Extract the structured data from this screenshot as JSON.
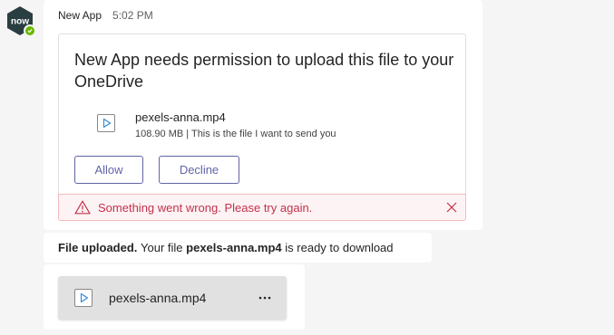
{
  "avatar": {
    "logo_text": "now",
    "icon": "servicenow-logo-icon",
    "presence_icon": "available-check-icon",
    "colors": {
      "hex": "#293e40",
      "text": "#ffffff",
      "presence": "#6bb700"
    }
  },
  "message": {
    "sender": "New App",
    "time": "5:02 PM",
    "card": {
      "title": "New App needs permission to upload this file to your OneDrive",
      "file": {
        "icon": "video-file-icon",
        "name": "pexels-anna.mp4",
        "description": "108.90 MB | This is the file I want to send you"
      },
      "actions": {
        "allow_label": "Allow",
        "decline_label": "Decline"
      },
      "error": {
        "icon": "warning-triangle-icon",
        "text": "Something went wrong. Please try again.",
        "close_icon": "close-icon"
      }
    }
  },
  "upload_status": {
    "bold_prefix": "File uploaded.",
    "text_middle": "Your file",
    "file_name": "pexels-anna.mp4",
    "text_suffix": "is ready to download"
  },
  "attachment": {
    "icon": "video-file-icon",
    "name": "pexels-anna.mp4",
    "more_label": "···",
    "more_icon": "more-options-icon"
  },
  "colors": {
    "accent": "#6264a7",
    "error_text": "#c4314b",
    "error_bg": "#fdf3f4",
    "error_border": "#f1bbbc"
  }
}
